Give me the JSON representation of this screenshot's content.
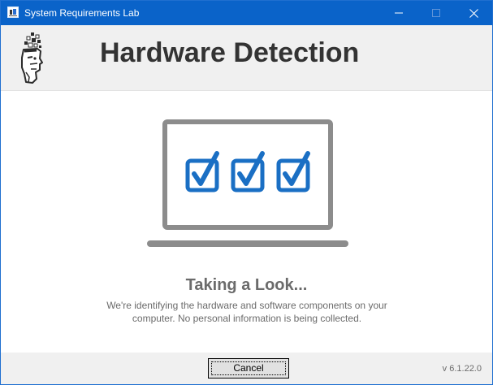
{
  "window": {
    "title": "System Requirements Lab",
    "controls": {
      "minimize_icon": "minimize-icon",
      "maximize_icon": "maximize-icon",
      "close_icon": "close-icon"
    }
  },
  "header": {
    "title": "Hardware Detection",
    "logo_icon": "srl-face-logo-icon"
  },
  "illustration": {
    "icon": "laptop-icon",
    "checkboxes": 3,
    "check_color": "#1a6fc4",
    "frame_color": "#8c8c8c"
  },
  "status": {
    "title": "Taking a Look...",
    "description": "We're identifying the hardware and software components on your computer. No personal information is being collected."
  },
  "footer": {
    "cancel_label": "Cancel",
    "version": "v 6.1.22.0"
  },
  "colors": {
    "titlebar": "#0a63c9",
    "header_bg": "#f0f0f0",
    "text_gray": "#6b6b6b",
    "title_text": "#333333"
  }
}
